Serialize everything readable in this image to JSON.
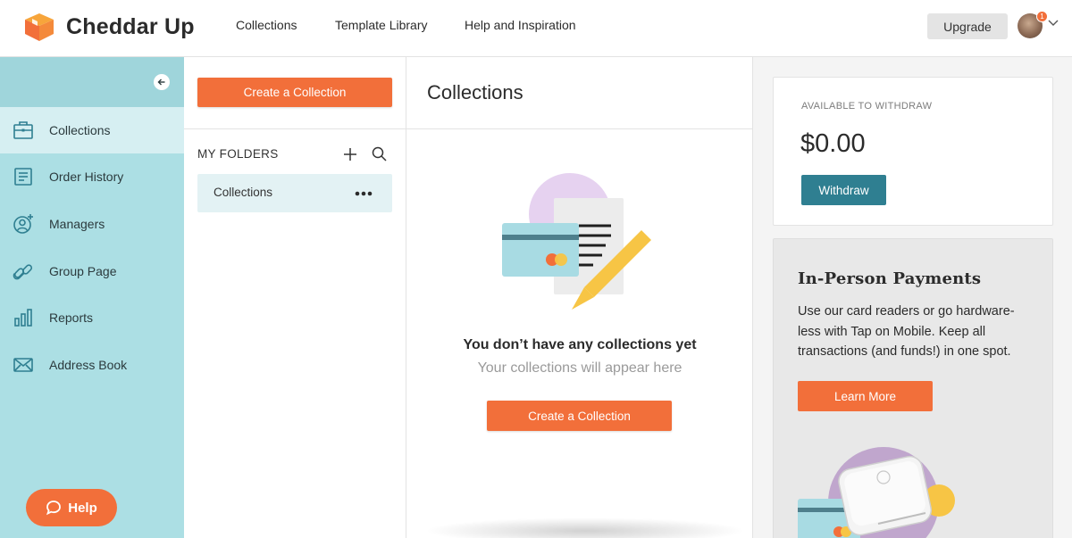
{
  "app": {
    "brand_name": "Cheddar Up"
  },
  "topnav": {
    "links": [
      "Collections",
      "Template Library",
      "Help and Inspiration"
    ],
    "upgrade_label": "Upgrade",
    "notification_count": "1"
  },
  "sidebar": {
    "items": [
      {
        "label": "Collections",
        "icon": "briefcase-icon",
        "active": true
      },
      {
        "label": "Order History",
        "icon": "receipt-icon",
        "active": false
      },
      {
        "label": "Managers",
        "icon": "add-user-icon",
        "active": false
      },
      {
        "label": "Group Page",
        "icon": "link-icon",
        "active": false
      },
      {
        "label": "Reports",
        "icon": "bar-chart-icon",
        "active": false
      },
      {
        "label": "Address Book",
        "icon": "envelope-icon",
        "active": false
      }
    ],
    "help_label": "Help"
  },
  "folders": {
    "create_label": "Create a Collection",
    "title": "MY FOLDERS",
    "items": [
      {
        "label": "Collections"
      }
    ]
  },
  "main": {
    "title": "Collections",
    "empty_title": "You don’t have any collections yet",
    "empty_subtitle": "Your collections will appear here",
    "create_label": "Create a Collection"
  },
  "right": {
    "withdraw_label": "AVAILABLE TO WITHDRAW",
    "balance": "$0.00",
    "withdraw_button": "Withdraw",
    "promo_title": "In-Person Payments",
    "promo_body": "Use our card readers or go hardware-less with Tap on Mobile. Keep all transactions (and funds!) in one spot.",
    "learn_more_label": "Learn More"
  },
  "colors": {
    "accent": "#f26f3a",
    "sidebar_bg": "#acdfe4",
    "sidebar_active": "#d6eff2",
    "withdraw_button": "#2f7f91"
  }
}
